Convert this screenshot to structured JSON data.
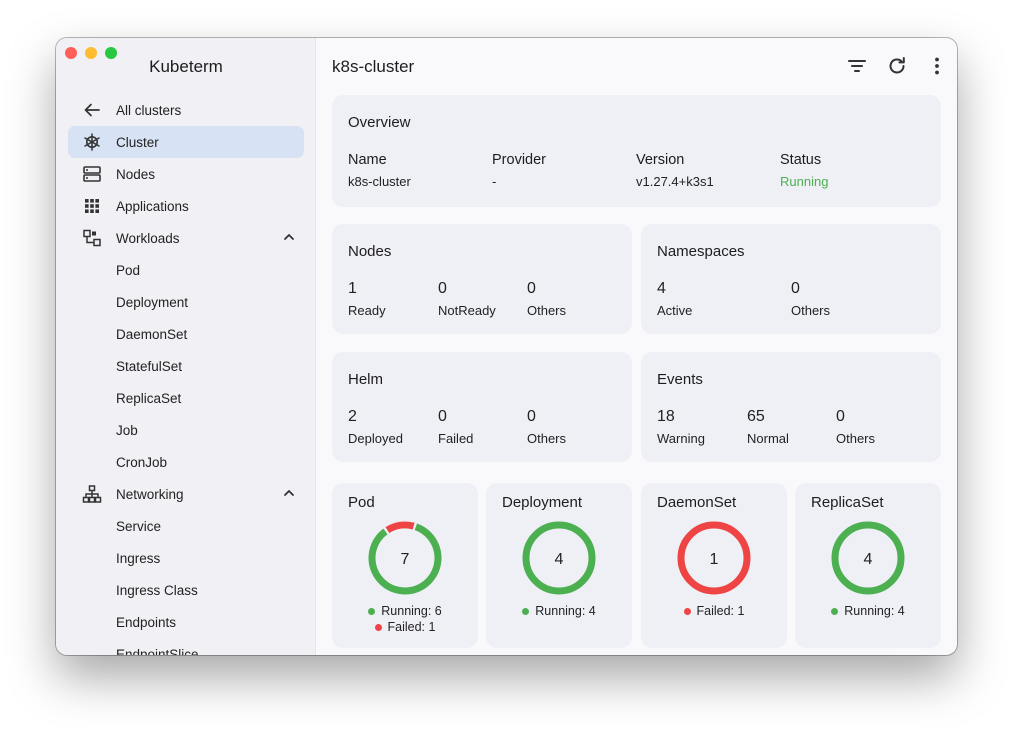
{
  "app": {
    "title": "Kubeterm"
  },
  "sidebar": {
    "back_label": "All clusters",
    "items": [
      {
        "label": "Cluster",
        "icon": "kubernetes-helm-icon",
        "active": true
      },
      {
        "label": "Nodes",
        "icon": "server-icon"
      },
      {
        "label": "Applications",
        "icon": "grid-icon"
      },
      {
        "label": "Workloads",
        "icon": "workloads-icon",
        "expanded": true
      },
      {
        "label": "Pod"
      },
      {
        "label": "Deployment"
      },
      {
        "label": "DaemonSet"
      },
      {
        "label": "StatefulSet"
      },
      {
        "label": "ReplicaSet"
      },
      {
        "label": "Job"
      },
      {
        "label": "CronJob"
      },
      {
        "label": "Networking",
        "icon": "network-icon",
        "expanded": true
      },
      {
        "label": "Service"
      },
      {
        "label": "Ingress"
      },
      {
        "label": "Ingress Class"
      },
      {
        "label": "Endpoints"
      },
      {
        "label": "EndpointSlice"
      }
    ]
  },
  "header": {
    "title": "k8s-cluster",
    "icons": [
      "filter-icon",
      "refresh-icon",
      "more-vertical-icon"
    ]
  },
  "overview": {
    "title": "Overview",
    "fields": [
      {
        "label": "Name",
        "value": "k8s-cluster"
      },
      {
        "label": "Provider",
        "value": "-"
      },
      {
        "label": "Version",
        "value": "v1.27.4+k3s1"
      },
      {
        "label": "Status",
        "value": "Running"
      }
    ]
  },
  "nodes": {
    "title": "Nodes",
    "stats": [
      {
        "value": "1",
        "label": "Ready"
      },
      {
        "value": "0",
        "label": "NotReady"
      },
      {
        "value": "0",
        "label": "Others"
      }
    ]
  },
  "namespaces": {
    "title": "Namespaces",
    "stats": [
      {
        "value": "4",
        "label": "Active"
      },
      {
        "value": "0",
        "label": "Others"
      }
    ]
  },
  "helm": {
    "title": "Helm",
    "stats": [
      {
        "value": "2",
        "label": "Deployed"
      },
      {
        "value": "0",
        "label": "Failed"
      },
      {
        "value": "0",
        "label": "Others"
      }
    ]
  },
  "events": {
    "title": "Events",
    "stats": [
      {
        "value": "18",
        "label": "Warning"
      },
      {
        "value": "65",
        "label": "Normal"
      },
      {
        "value": "0",
        "label": "Others"
      }
    ]
  },
  "colors": {
    "green": "#4caf50",
    "red": "#ef4444",
    "accent_bg": "#d7e3f4"
  },
  "workloads": [
    {
      "title": "Pod",
      "total": "7",
      "segments": [
        {
          "label": "Running: 6",
          "value": 6,
          "color": "#4caf50"
        },
        {
          "label": "Failed: 1",
          "value": 1,
          "color": "#ef4444"
        }
      ]
    },
    {
      "title": "Deployment",
      "total": "4",
      "segments": [
        {
          "label": "Running: 4",
          "value": 4,
          "color": "#4caf50"
        }
      ]
    },
    {
      "title": "DaemonSet",
      "total": "1",
      "segments": [
        {
          "label": "Failed: 1",
          "value": 1,
          "color": "#ef4444"
        }
      ]
    },
    {
      "title": "ReplicaSet",
      "total": "4",
      "segments": [
        {
          "label": "Running: 4",
          "value": 4,
          "color": "#4caf50"
        }
      ]
    }
  ]
}
